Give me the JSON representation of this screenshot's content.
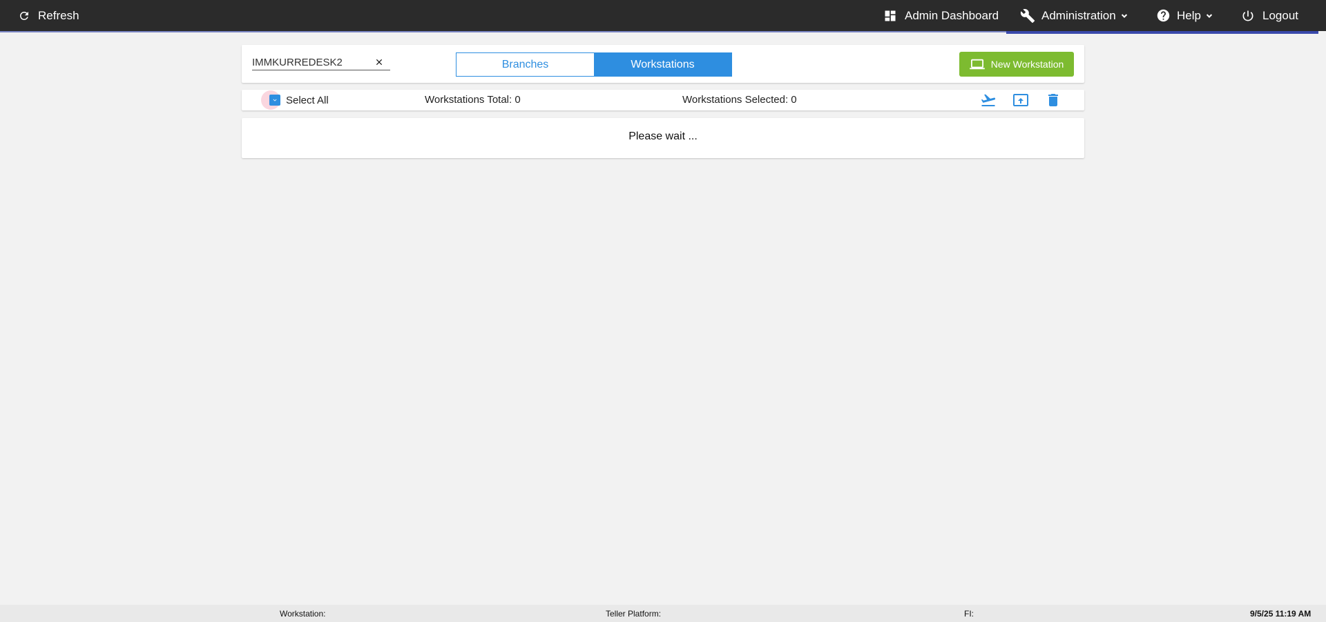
{
  "topbar": {
    "refresh_label": "Refresh",
    "dashboard_label": "Admin Dashboard",
    "administration_label": "Administration",
    "help_label": "Help",
    "logout_label": "Logout",
    "accent_color": "#3949ab"
  },
  "search": {
    "value": "IMMKURREDESK2",
    "clear_icon": "close-icon"
  },
  "toggle": {
    "branches_label": "Branches",
    "workstations_label": "Workstations",
    "active": "Workstations"
  },
  "new_button": {
    "label": "New Workstation",
    "icon": "laptop-icon",
    "color": "#7dbb30"
  },
  "list_header": {
    "select_all_label": "Select All",
    "select_all_checked": true,
    "total_text": "Workstations Total: 0",
    "selected_text": "Workstations Selected: 0",
    "actions": [
      "departure-icon",
      "upload-icon",
      "trash-icon"
    ]
  },
  "content": {
    "status_text": "Please wait ..."
  },
  "footer": {
    "workstation_label": "Workstation:",
    "teller_platform_label": "Teller Platform:",
    "fi_label": "FI:",
    "datetime": "9/5/25 11:19 AM"
  },
  "colors": {
    "primary": "#2e8ee0",
    "topbar_bg": "#2b2b2b",
    "page_bg": "#f2f2f2"
  }
}
